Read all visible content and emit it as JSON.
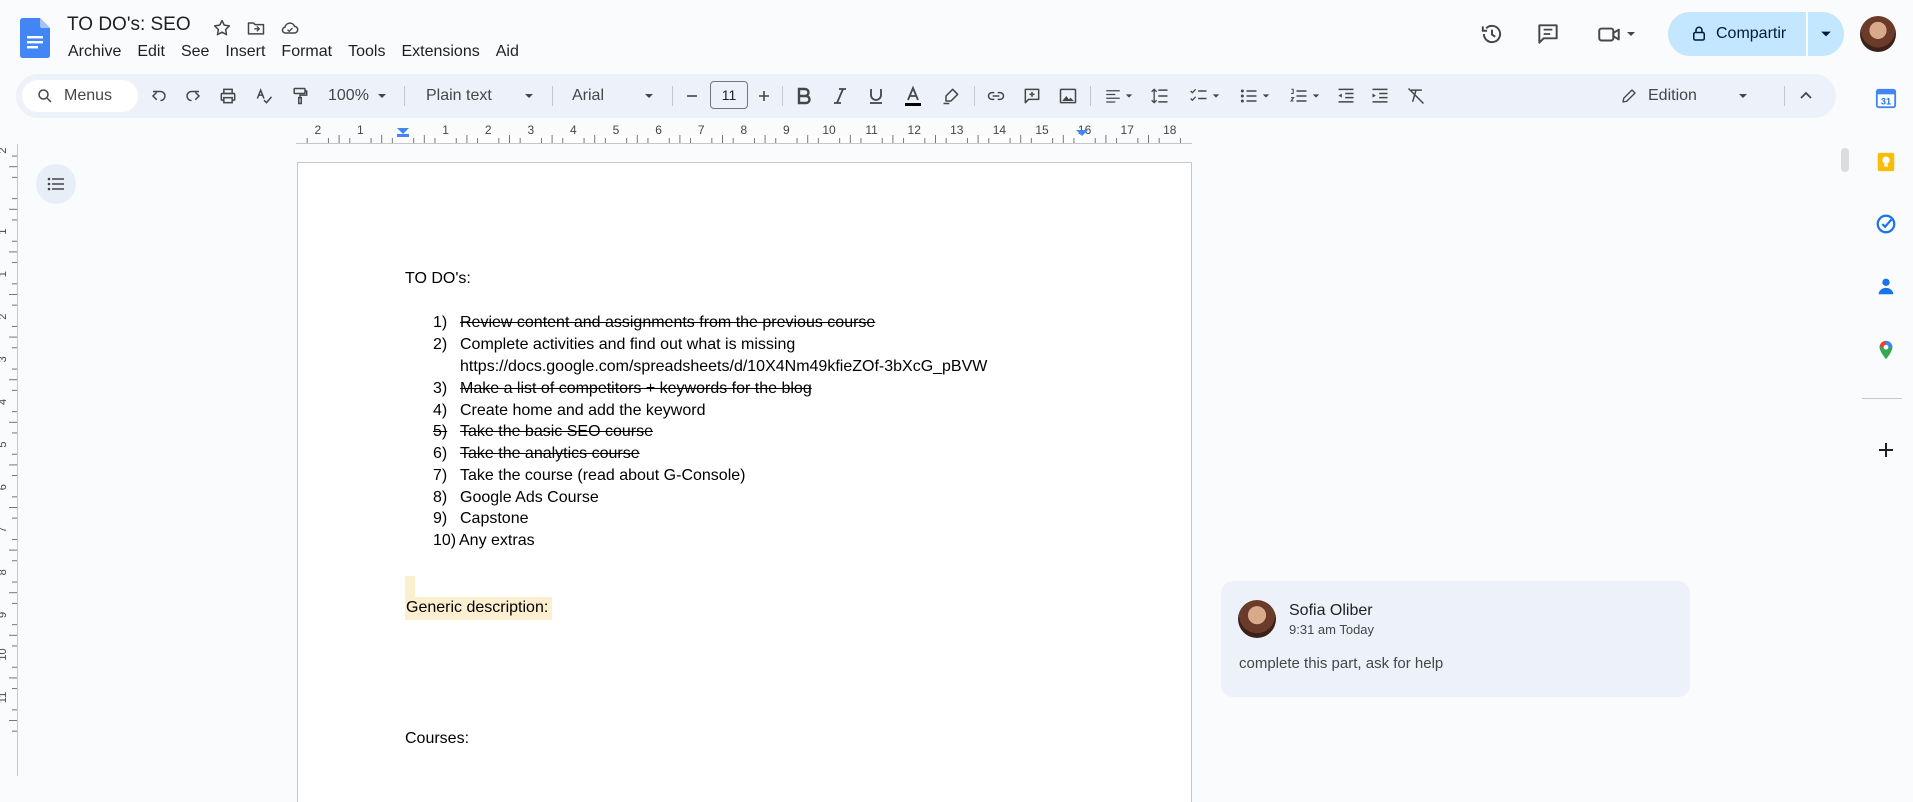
{
  "header": {
    "title": "TO DO's: SEO",
    "menus": [
      "Archive",
      "Edit",
      "See",
      "Insert",
      "Format",
      "Tools",
      "Extensions",
      "Aid"
    ],
    "share_label": "Compartir"
  },
  "toolbar": {
    "search_label": "Menus",
    "zoom": "100%",
    "style": "Plain text",
    "font": "Arial",
    "font_size": "11",
    "mode": "Edition"
  },
  "ruler": {
    "numbers": [
      "2",
      "1",
      "1",
      "2",
      "3",
      "4",
      "5",
      "6",
      "7",
      "8",
      "9",
      "10",
      "11",
      "12",
      "13",
      "14",
      "15",
      "16",
      "17",
      "18"
    ],
    "vnumbers": [
      "2",
      "1",
      "1",
      "2",
      "3",
      "4",
      "5",
      "6",
      "7",
      "8",
      "9",
      "10",
      "11"
    ]
  },
  "document": {
    "heading": "TO DO's:",
    "items": [
      {
        "num": "1)",
        "text": "Review content and assignments from the previous course",
        "done": true
      },
      {
        "num": "2)",
        "text": "Complete activities and find out what is missing",
        "done": false
      },
      {
        "num": "",
        "text": "https://docs.google.com/spreadsheets/d/10X4Nm49kfieZOf-3bXcG_pBVW",
        "done": false
      },
      {
        "num": "3)",
        "text": "Make a list of competitors + keywords for the blog",
        "done": true
      },
      {
        "num": "4)",
        "text": "Create home and add the keyword",
        "done": false
      },
      {
        "num": "5)",
        "text": "Take the basic SEO course",
        "done": true
      },
      {
        "num": "6)",
        "text": "Take the analytics course",
        "done": true
      },
      {
        "num": "7)",
        "text": "Take the course (read about G-Console)",
        "done": false
      },
      {
        "num": "8)",
        "text": "Google Ads Course",
        "done": false
      },
      {
        "num": "9)",
        "text": "Capstone",
        "done": false
      },
      {
        "num": "10)",
        "text": "Any extras",
        "done": false
      }
    ],
    "generic_description": "Generic description:",
    "courses": "Courses:"
  },
  "comment": {
    "author": "Sofia Oliber",
    "time": "9:31 am Today",
    "text": "complete this part, ask for help"
  },
  "colors": {
    "accent": "#0b57d0",
    "share_bg": "#c2e7ff",
    "toolbar_bg": "#edf2fa",
    "highlight": "#fcefd0"
  }
}
